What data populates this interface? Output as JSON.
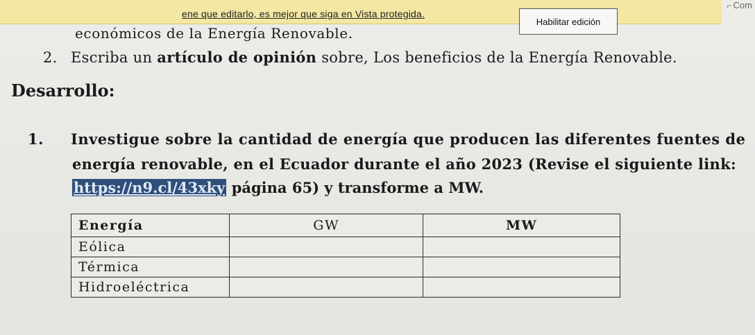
{
  "protected_view": {
    "message": "ene que editarlo, es mejor que siga en Vista protegida.",
    "enable_button": "Habilitar edición",
    "corner_label": "Com"
  },
  "document": {
    "line_econ": "económicos de la Energía Renovable.",
    "item2_number": "2.",
    "item2_prefix": "Escriba un ",
    "item2_bold": "artículo de opinión",
    "item2_rest": " sobre, Los beneficios de la Energía Renovable.",
    "section_title": "Desarrollo:",
    "q1_number": "1.",
    "q1_line1": "Investigue sobre la cantidad de energía que producen las diferentes fuentes de",
    "q1_line2": "energía renovable, en el Ecuador durante el año 2023 (Revise el siguiente link:",
    "q1_link": "https://n9.cl/43xky",
    "q1_line3_rest": " página 65) y transforme a MW."
  },
  "table": {
    "headers": [
      "Energía",
      "GW",
      "MW"
    ],
    "rows": [
      [
        "Eólica",
        "",
        ""
      ],
      [
        "Térmica",
        "",
        ""
      ],
      [
        "Hidroeléctrica",
        "",
        ""
      ]
    ]
  },
  "colors": {
    "protected_bar": "#f3e7a3",
    "link_highlight": "#2f4f7a"
  }
}
